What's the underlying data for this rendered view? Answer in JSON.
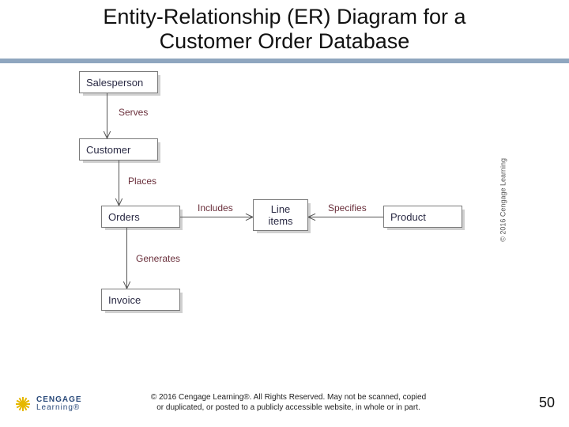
{
  "title_line1": "Entity-Relationship (ER) Diagram for a",
  "title_line2": "Customer Order Database",
  "entities": {
    "salesperson": "Salesperson",
    "customer": "Customer",
    "orders": "Orders",
    "invoice": "Invoice",
    "line_items_l1": "Line",
    "line_items_l2": "items",
    "product": "Product"
  },
  "relationships": {
    "serves": "Serves",
    "places": "Places",
    "generates": "Generates",
    "includes": "Includes",
    "specifies": "Specifies"
  },
  "side_copyright": "© 2016 Cengage Learning",
  "footer_line1": "© 2016 Cengage Learning®. All Rights Reserved. May not be scanned, copied",
  "footer_line2": "or duplicated, or posted to a publicly accessible website, in whole or in part.",
  "logo_top": "CENGAGE",
  "logo_bottom": "Learning®",
  "page_number": "50"
}
